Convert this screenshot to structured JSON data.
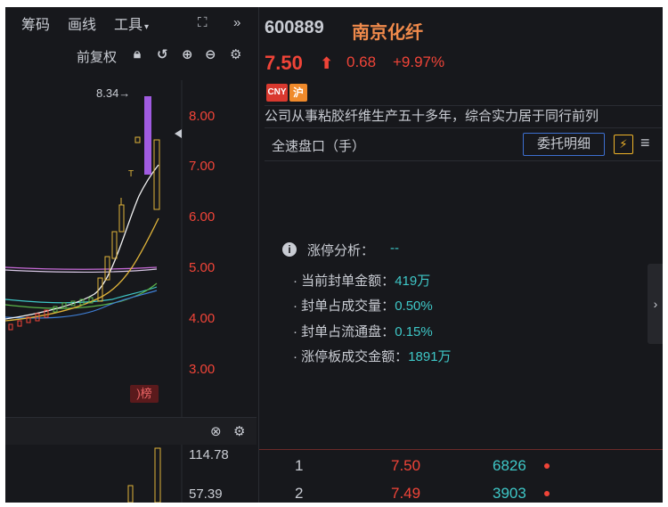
{
  "toolbar": {
    "items": [
      "筹码",
      "画线",
      "工具"
    ],
    "tools_caret": "▾",
    "expand_icon": "expand-icon",
    "collapse_icon": "double-chevron-right-icon"
  },
  "subbar": {
    "adjust_label": "前复权",
    "icons": [
      "lock-icon",
      "undo-icon",
      "zoom-in-icon",
      "zoom-out-icon",
      "gear-icon"
    ]
  },
  "stock": {
    "code": "600889",
    "name": "南京化纤",
    "price": "7.50",
    "change": "0.68",
    "pct": "+9.97%",
    "badge_cny": "CNY",
    "badge_market": "沪",
    "summary": "公司从事粘胶纤维生产五十多年，综合实力居于同行前列"
  },
  "orderbook_header": {
    "title": "全速盘口（手）",
    "detail_button": "委托明细",
    "bolt": "⚡",
    "menu": "≡"
  },
  "limit_analysis": {
    "title": "涨停分析：",
    "status": "--",
    "rows": [
      {
        "label": "当前封单金额：",
        "value": "419万"
      },
      {
        "label": "封单占成交量：",
        "value": "0.50%"
      },
      {
        "label": "封单占流通盘：",
        "value": "0.15%"
      },
      {
        "label": "涨停板成交金额：",
        "value": "1891万"
      }
    ]
  },
  "side_tab": "›",
  "book_rows": [
    {
      "idx": "1",
      "price": "7.50",
      "vol": "6826"
    },
    {
      "idx": "2",
      "price": "7.49",
      "vol": "3903"
    }
  ],
  "kline": {
    "axis_labels": [
      "8.00",
      "7.00",
      "6.00",
      "5.00",
      "4.00",
      "3.00"
    ],
    "high_label": "8.34→",
    "tag": "龙虎榜",
    "tag_visible": ")榜"
  },
  "volume": {
    "axis_labels": [
      "114.78",
      "57.39"
    ],
    "icons": [
      "close-icon",
      "gear-icon"
    ]
  },
  "colors": {
    "up": "#f04438",
    "teal": "#3ec7c7",
    "name": "#f08a4b",
    "bg": "#17181c",
    "purple": "#a05be0",
    "gold": "#e0b43a"
  }
}
